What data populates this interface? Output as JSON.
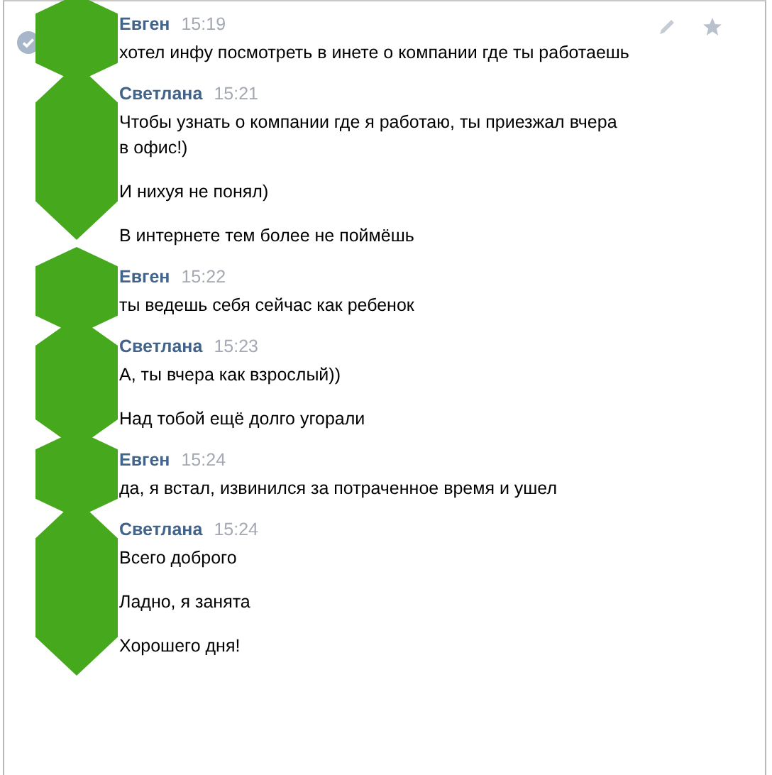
{
  "messages": [
    {
      "author": "Евген",
      "time": "15:19",
      "selected": true,
      "paragraphs": [
        "хотел инфу посмотреть в инете о компании где ты работаешь"
      ]
    },
    {
      "author": "Светлана",
      "time": "15:21",
      "selected": false,
      "paragraphs": [
        "Чтобы узнать о компании где я работаю, ты приезжал вчера в офис!)",
        "И нихуя не понял)",
        "В интернете тем более не поймёшь"
      ]
    },
    {
      "author": "Евген",
      "time": "15:22",
      "selected": false,
      "paragraphs": [
        "ты ведешь себя сейчас как ребенок"
      ]
    },
    {
      "author": "Светлана",
      "time": "15:23",
      "selected": false,
      "paragraphs": [
        "А, ты вчера как взрослый))",
        "Над тобой ещё долго угорали"
      ]
    },
    {
      "author": "Евген",
      "time": "15:24",
      "selected": false,
      "paragraphs": [
        "да, я встал, извинился за потраченное время и ушел"
      ]
    },
    {
      "author": "Светлана",
      "time": "15:24",
      "selected": false,
      "paragraphs": [
        "Всего доброго",
        "Ладно, я занята",
        "Хорошего дня!"
      ]
    }
  ]
}
